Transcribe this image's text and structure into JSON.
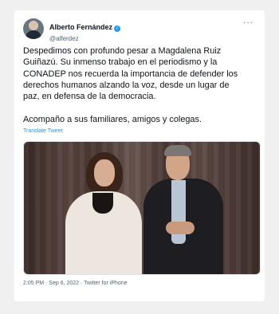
{
  "tweet": {
    "author": {
      "display_name": "Alberto Fernández",
      "handle": "@alferdez",
      "verified": true,
      "verified_glyph": "✓",
      "avatar_icon": "avatar-photo"
    },
    "more_glyph": "···",
    "text": "Despedimos con profundo pesar a Magdalena Ruiz\nGuiñazú. Su inmenso trabajo en el periodismo y la\nCONADEP nos recuerda la importancia de defender los\nderechos humanos alzando la voz, desde un lugar de\npaz, en defensa de la democracia.\n\nAcompaño a sus familiares, amigos y colegas.",
    "translate_label": "Translate Tweet",
    "timestamp": "2:05 PM · Sep 6, 2022 · Twitter for iPhone"
  },
  "colors": {
    "link": "#1d9bf0",
    "text": "#0f1419",
    "muted": "#536471"
  }
}
